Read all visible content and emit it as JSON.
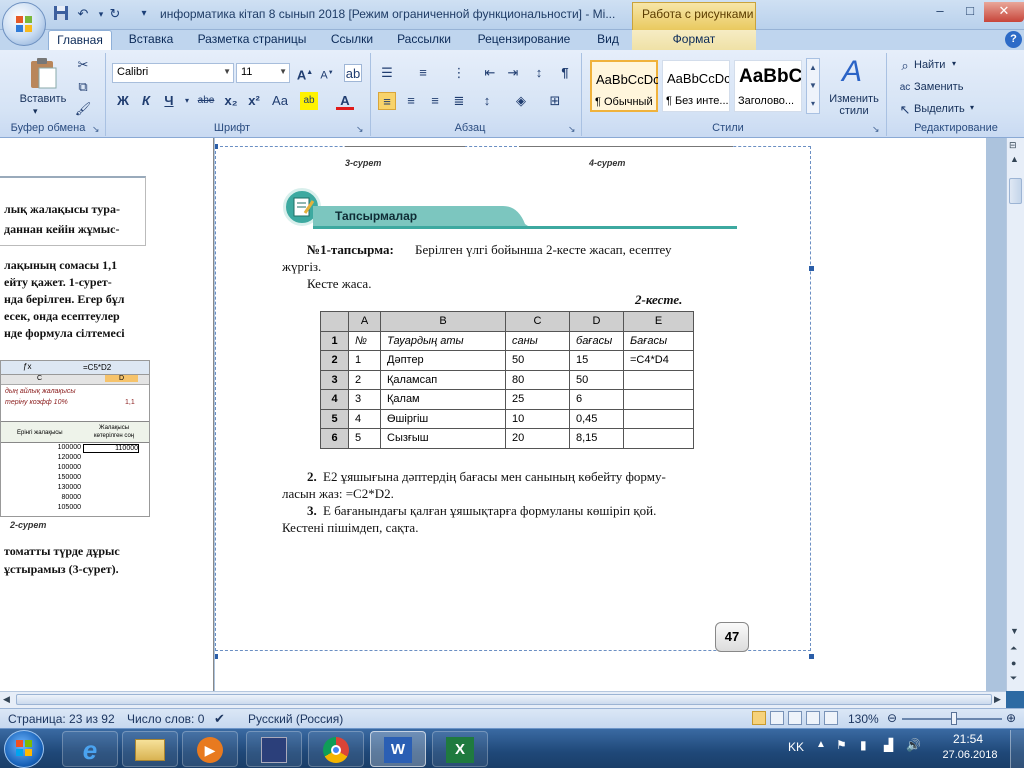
{
  "window": {
    "title": "информатика кітап 8 сынып 2018 [Режим ограниченной функциональности] - Mi...",
    "context_header": "Работа с рисунками",
    "buttons": {
      "minimize": "–",
      "maximize": "□",
      "close": "✕"
    }
  },
  "quick_access": [
    "save-icon",
    "undo-icon",
    "redo-icon",
    "customize-icon"
  ],
  "tabs": [
    {
      "label": "Главная",
      "active": true
    },
    {
      "label": "Вставка"
    },
    {
      "label": "Разметка страницы"
    },
    {
      "label": "Ссылки"
    },
    {
      "label": "Рассылки"
    },
    {
      "label": "Рецензирование"
    },
    {
      "label": "Вид"
    },
    {
      "label": "Формат",
      "contextual": true
    }
  ],
  "ribbon": {
    "clipboard": {
      "label": "Буфер обмена",
      "paste": "Вставить"
    },
    "font": {
      "label": "Шрифт",
      "name": "Calibri",
      "size": "11",
      "buttons": [
        "Ж",
        "К",
        "Ч",
        "abe",
        "x₂",
        "x²",
        "Aa"
      ]
    },
    "paragraph": {
      "label": "Абзац"
    },
    "styles": {
      "label": "Стили",
      "items": [
        {
          "sample": "AaBbCcDc",
          "name": "¶ Обычный",
          "selected": true
        },
        {
          "sample": "AaBbCcDc",
          "name": "¶ Без инте..."
        },
        {
          "sample": "AaBbC",
          "name": "Заголово..."
        }
      ],
      "change": "Изменить стили"
    },
    "editing": {
      "label": "Редактирование",
      "find": "Найти",
      "replace": "Заменить",
      "select": "Выделить"
    }
  },
  "left_page": {
    "lines1": [
      "лық жалақысы тура-",
      "даннан кейін жұмыс-"
    ],
    "lines2": [
      "лақының сомасы 1,1",
      "ейту қажет. 1-сурет-",
      "нда берілген. Егер бұл",
      "есек, онда есептеулер",
      "нде формула сілтемесі"
    ],
    "formula": "=C5*D2",
    "col_c": "C",
    "col_d": "D",
    "row_a": "дың айлық жалақысы",
    "row_b": "теріну коэфф 10%",
    "row_b_val": "1,1",
    "hdr1": "Ерінгі жалақысы",
    "hdr2": "Жалақысы көтерілген соң",
    "values": [
      "100000",
      "120000",
      "100000",
      "150000",
      "130000",
      "80000",
      "105000"
    ],
    "first_result": "110000",
    "caption": "2-сурет",
    "bottom": [
      "томатты түрде дұрыс",
      "ұстырамыз (3-сурет)."
    ]
  },
  "main_page": {
    "fig3": "3-сурет",
    "fig4": "4-сурет",
    "banner": "Тапсырмалар",
    "task1_bold": "№1-тапсырма:",
    "task1_text": "Берілген үлгі бойынша 2-кесте жасап, есептеу",
    "task1_text2": "жүргіз.",
    "make_table": "Кесте жаса.",
    "table_caption": "2-кесте.",
    "table": {
      "col_headers": [
        "A",
        "B",
        "C",
        "D",
        "E"
      ],
      "rows": [
        {
          "n": "1",
          "cells": [
            "№",
            "Тауардың аты",
            "саны",
            "бағасы",
            "Бағасы"
          ]
        },
        {
          "n": "2",
          "cells": [
            "1",
            "Дәптер",
            "50",
            "15",
            "=C4*D4"
          ]
        },
        {
          "n": "3",
          "cells": [
            "2",
            "Қаламсап",
            "80",
            "50",
            ""
          ]
        },
        {
          "n": "4",
          "cells": [
            "3",
            "Қалам",
            "25",
            "6",
            ""
          ]
        },
        {
          "n": "5",
          "cells": [
            "4",
            "Өшіргіш",
            "10",
            "0,45",
            ""
          ]
        },
        {
          "n": "6",
          "cells": [
            "5",
            "Сызғыш",
            "20",
            "8,15",
            ""
          ]
        }
      ]
    },
    "item2_num": "2.",
    "item2_line1": "Е2 ұяшығына дәптердің бағасы мен санының көбейту форму-",
    "item2_line2": "ласын жаз: =C2*D2.",
    "item3_num": "3.",
    "item3_line1": "Е бағанындағы қалған ұяшықтарға формуланы көшіріп қой.",
    "item3_line2": "Кестені пішімдеп, сақта.",
    "page_number": "47"
  },
  "statusbar": {
    "page": "Страница: 23 из 92",
    "words": "Число слов: 0",
    "language": "Русский (Россия)",
    "zoom": "130%"
  },
  "taskbar": {
    "apps": [
      "start-orb",
      "ie-icon",
      "explorer-icon",
      "media-player-icon",
      "save-drive-icon",
      "chrome-icon",
      "word-icon",
      "excel-icon"
    ],
    "lang": "KK",
    "time": "21:54",
    "date": "27.06.2018"
  }
}
